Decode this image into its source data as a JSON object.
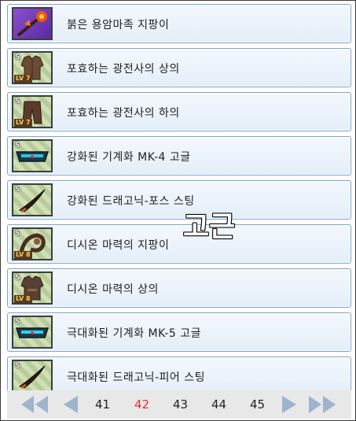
{
  "items": [
    {
      "name": "붉은 용암마족 지팡이",
      "icon": "fire-staff-icon",
      "badge_s": "",
      "badge_lv": ""
    },
    {
      "name": "포효하는 광전사의 상의",
      "icon": "leather-vest-icon",
      "badge_s": "S",
      "badge_lv": "LV 7"
    },
    {
      "name": "포효하는 광전사의 하의",
      "icon": "leather-pants-icon",
      "badge_s": "S",
      "badge_lv": "LV 7"
    },
    {
      "name": "강화된 기계화 MK-4 고글",
      "icon": "goggles-icon",
      "badge_s": "S",
      "badge_lv": ""
    },
    {
      "name": "강화된 드래고닉-포스 스팅",
      "icon": "dragon-sting-icon",
      "badge_s": "S",
      "badge_lv": ""
    },
    {
      "name": "디시온 마력의 지팡이",
      "icon": "magic-staff-icon",
      "badge_s": "S",
      "badge_lv": "LV 8"
    },
    {
      "name": "디시온 마력의 상의",
      "icon": "robe-top-icon",
      "badge_s": "S",
      "badge_lv": "LV 8"
    },
    {
      "name": "극대화된 기계화 MK-5 고글",
      "icon": "goggles-icon",
      "badge_s": "S",
      "badge_lv": ""
    },
    {
      "name": "극대화된 드래고닉-피어 스팅",
      "icon": "dragon-sting-icon",
      "badge_s": "S",
      "badge_lv": ""
    }
  ],
  "watermark": "고근",
  "pagination": {
    "pages": [
      "41",
      "42",
      "43",
      "44",
      "45"
    ],
    "current": "42",
    "active_color": "#e03030"
  },
  "colors": {
    "row_border": "#7fa3c7",
    "row_fill": "#e4eef8"
  }
}
